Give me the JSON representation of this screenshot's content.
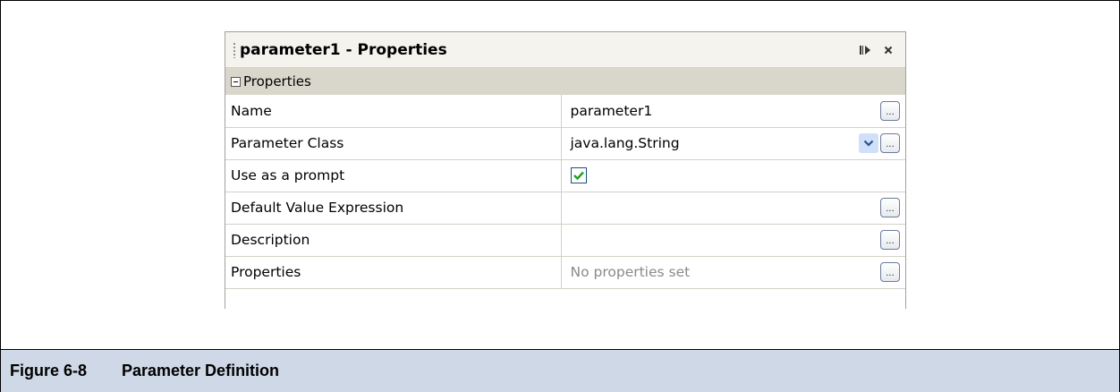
{
  "panel": {
    "title": "parameter1 - Properties",
    "section_label": "Properties",
    "rows": [
      {
        "name": "Name",
        "value": "parameter1",
        "muted": false,
        "control": "ellipsis"
      },
      {
        "name": "Parameter Class",
        "value": "java.lang.String",
        "muted": false,
        "control": "dropdown-ellipsis"
      },
      {
        "name": "Use as a prompt",
        "value": "",
        "muted": false,
        "control": "checkbox",
        "checked": true
      },
      {
        "name": "Default Value Expression",
        "value": "",
        "muted": false,
        "control": "ellipsis"
      },
      {
        "name": "Description",
        "value": "",
        "muted": false,
        "control": "ellipsis"
      },
      {
        "name": "Properties",
        "value": "No properties set",
        "muted": true,
        "control": "ellipsis"
      }
    ],
    "ellipsis_label": "..."
  },
  "caption": {
    "number": "Figure 6-8",
    "title": "Parameter Definition"
  },
  "colors": {
    "caption_bg": "#cfd8e6",
    "section_bg": "#d9d6cc",
    "checkmark": "#21a121"
  }
}
